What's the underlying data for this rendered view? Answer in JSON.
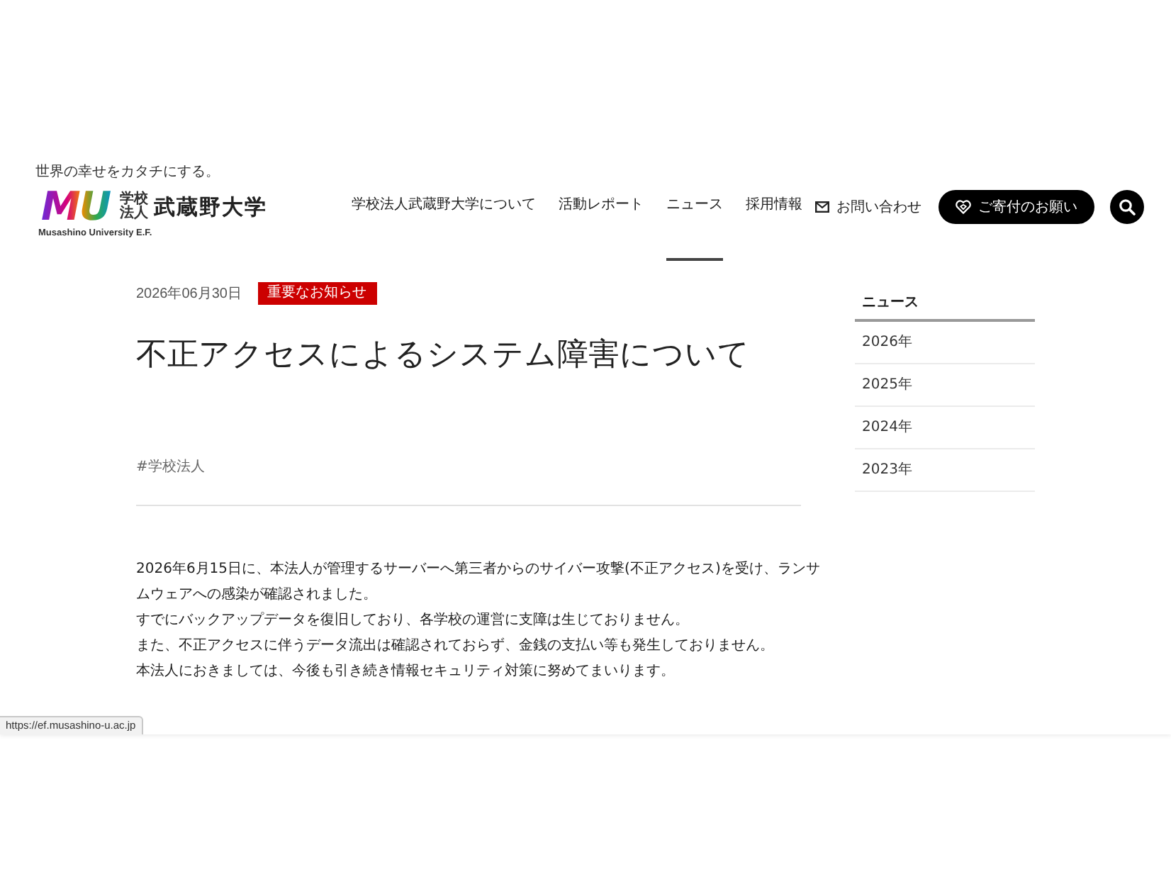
{
  "header": {
    "logo": {
      "tagline": "世界の幸せをカタチにする。",
      "mark": "MU",
      "corporation": "学校法人",
      "name": "武蔵野大学",
      "english_name": "Musashino University E.F."
    },
    "nav": [
      {
        "label": "学校法人武蔵野大学について",
        "selected": false
      },
      {
        "label": "活動レポート",
        "selected": false
      },
      {
        "label": "ニュース",
        "selected": true
      },
      {
        "label": "採用情報",
        "selected": false
      }
    ],
    "contact_link": "お問い合わせ",
    "donate_button": "ご寄付のお願い"
  },
  "article": {
    "date": "2026年06月30日",
    "category": "重要なお知らせ",
    "title": "不正アクセスによるシステム障害について",
    "tags": [
      "#学校法人"
    ],
    "paragraphs": [
      "2026年6月15日に、本法人が管理するサーバーへ第三者からのサイバー攻撃(不正アクセス)を受け、ランサムウェアへの感染が確認されました。",
      "すでにバックアップデータを復旧しており、各学校の運営に支障は生じておりません。",
      "また、不正アクセスに伴うデータ流出は確認されておらず、金銭の支払い等も発生しておりません。",
      "本法人におきましては、今後も引き続き情報セキュリティ対策に努めてまいります。"
    ]
  },
  "sidebar": {
    "heading": "ニュース",
    "items": [
      "2026年",
      "2025年",
      "2024年",
      "2023年"
    ]
  },
  "status_bar": {
    "url": "https://ef.musashino-u.ac.jp"
  }
}
